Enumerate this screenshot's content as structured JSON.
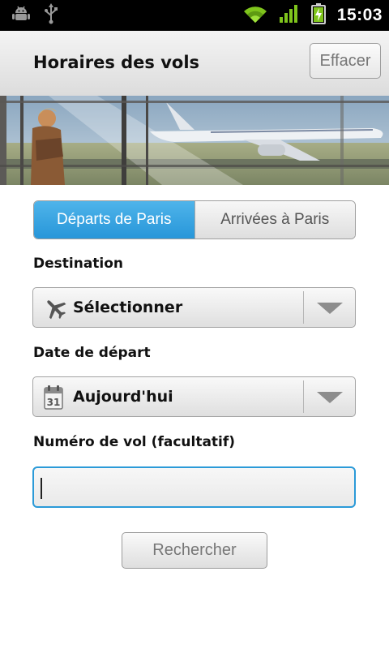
{
  "status_bar": {
    "time": "15:03",
    "icons": [
      "android-debug-icon",
      "usb-icon",
      "wifi-icon",
      "signal-icon",
      "battery-charging-icon"
    ]
  },
  "header": {
    "title": "Horaires des vols",
    "clear_label": "Effacer"
  },
  "banner": {
    "image": "airport-window-airplane-photo"
  },
  "tabs": [
    {
      "label": "Départs de Paris",
      "selected": true
    },
    {
      "label": "Arrivées à Paris",
      "selected": false
    }
  ],
  "form": {
    "destination": {
      "label": "Destination",
      "value": "Sélectionner",
      "icon": "airplane-icon"
    },
    "date": {
      "label": "Date de départ",
      "value": "Aujourd'hui",
      "icon": "calendar-icon",
      "calendar_day": "31"
    },
    "flight_number": {
      "label": "Numéro de vol (facultatif)",
      "value": "",
      "placeholder": ""
    },
    "search_label": "Rechercher"
  },
  "colors": {
    "accent": "#2796d9",
    "status_bar": "#000000",
    "wifi_signal": "#7fc41c"
  }
}
